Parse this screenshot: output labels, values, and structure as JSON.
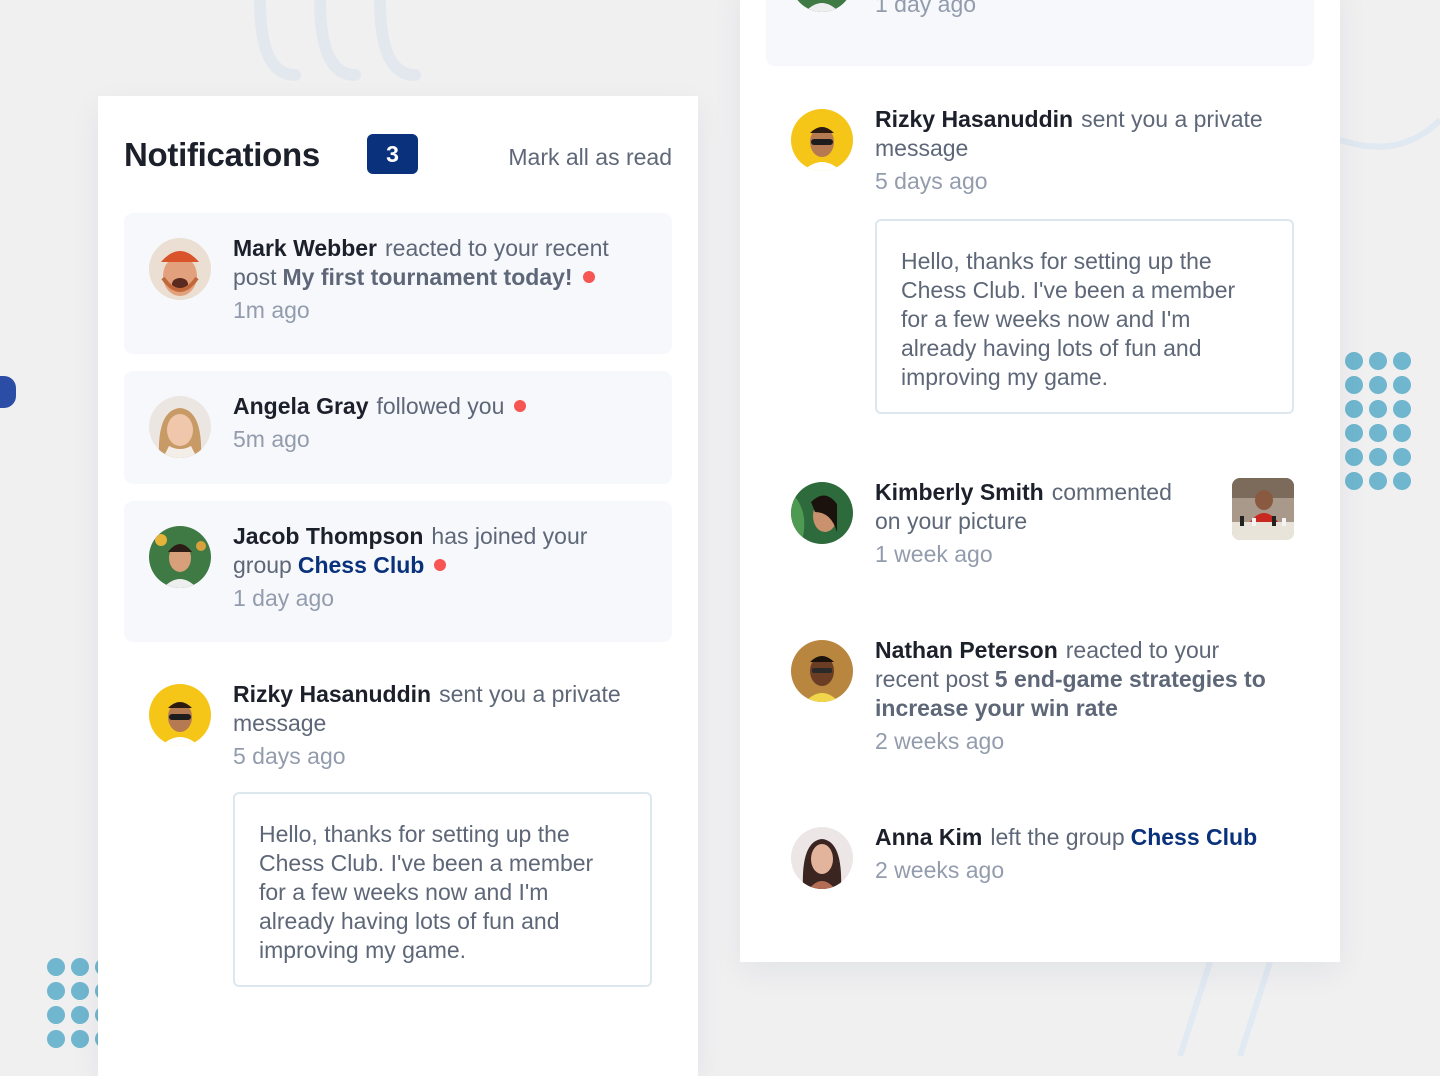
{
  "notifications_title": "Notifications",
  "unread_count": "3",
  "mark_all_label": "Mark all as read",
  "colors": {
    "accent": "#0a317b",
    "unread_bg": "#f6f8fc",
    "dot_red": "#f65552",
    "deco_teal": "#6fb6ce"
  },
  "left_panel": {
    "items": [
      {
        "name": "Mark Webber",
        "action": "reacted to your recent post",
        "post": "My first tournament today!",
        "time": "1m ago",
        "unread": true,
        "avatar": "avatar-mark-webber"
      },
      {
        "name": "Angela Gray",
        "action": "followed you",
        "time": "5m ago",
        "unread": true,
        "avatar": "avatar-angela-gray"
      },
      {
        "name": "Jacob Thompson",
        "action": "has joined your group",
        "group": "Chess Club",
        "time": "1 day ago",
        "unread": true,
        "avatar": "avatar-jacob-thompson"
      },
      {
        "name": "Rizky Hasanuddin",
        "action": "sent you a private message",
        "time": "5 days ago",
        "message": "Hello, thanks for setting up the Chess Club. I've been a member for a few weeks now and I'm already having lots of fun and improving my game.",
        "avatar": "avatar-rizky-hasanuddin"
      }
    ]
  },
  "right_panel": {
    "items": [
      {
        "time": "1 day ago",
        "unread": true
      },
      {
        "name": "Rizky Hasanuddin",
        "action": "sent you a private message",
        "time": "5 days ago",
        "message": "Hello, thanks for setting up the Chess Club. I've been a member for a few weeks now and I'm already having lots of fun and improving my game.",
        "avatar": "avatar-rizky-hasanuddin"
      },
      {
        "name": "Kimberly Smith",
        "action": "commented on your picture",
        "time": "1 week ago",
        "avatar": "avatar-kimberly-smith",
        "thumbnail": "chess-picture-thumbnail"
      },
      {
        "name": "Nathan Peterson",
        "action": "reacted to your recent post",
        "post": "5 end-game strategies to increase your win rate",
        "time": "2 weeks ago",
        "avatar": "avatar-nathan-peterson"
      },
      {
        "name": "Anna Kim",
        "action": "left the group",
        "group": "Chess Club",
        "time": "2 weeks ago",
        "avatar": "avatar-anna-kim"
      }
    ]
  }
}
